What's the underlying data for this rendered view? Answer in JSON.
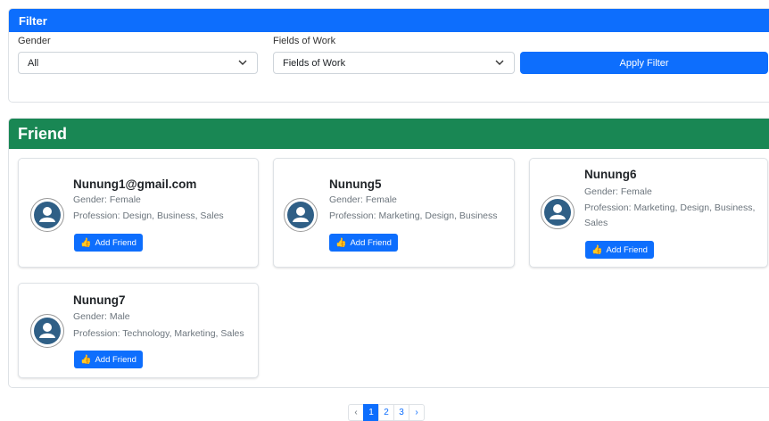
{
  "filter": {
    "title": "Filter",
    "gender_label": "Gender",
    "gender_value": "All",
    "work_label": "Fields of Work",
    "work_value": "Fields of Work",
    "apply_label": "Apply Filter"
  },
  "friends_section": {
    "title": "Friend",
    "items": [
      {
        "name": "Nunung1@gmail.com",
        "gender": "Gender: Female",
        "profession": "Profession: Design, Business, Sales",
        "button": "Add Friend"
      },
      {
        "name": "Nunung5",
        "gender": "Gender: Female",
        "profession": "Profession: Marketing, Design, Business",
        "button": "Add Friend"
      },
      {
        "name": "Nunung6",
        "gender": "Gender: Female",
        "profession": "Profession: Marketing, Design, Business, Sales",
        "button": "Add Friend"
      },
      {
        "name": "Nunung7",
        "gender": "Gender: Male",
        "profession": "Profession: Technology, Marketing, Sales",
        "button": "Add Friend"
      }
    ]
  },
  "pagination": {
    "prev": "‹",
    "pages": [
      "1",
      "2",
      "3"
    ],
    "active_page": "1",
    "next": "›"
  },
  "icons": {
    "avatar": "user-avatar-icon",
    "button": "thumbs-up-icon",
    "select": "chevron-down-icon"
  },
  "colors": {
    "primary": "#0d6efd",
    "success": "#198754",
    "avatar": "#2f5f86"
  }
}
